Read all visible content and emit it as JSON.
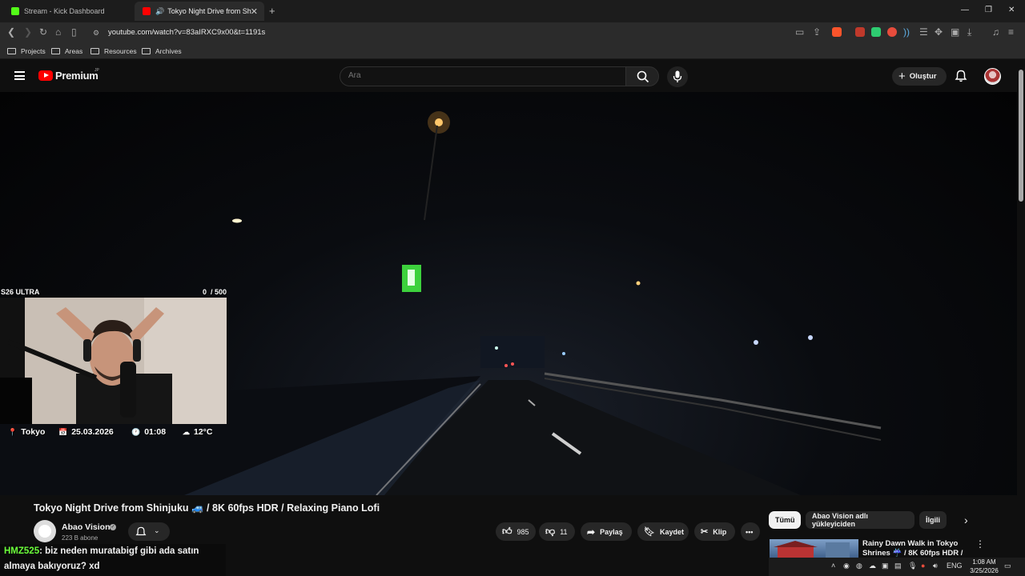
{
  "browser": {
    "tabs": [
      {
        "title": "Stream - Kick Dashboard",
        "active": false
      },
      {
        "title": "Tokyo Night Drive from Shinj",
        "active": true
      }
    ],
    "url": "youtube.com/watch?v=83aIRXC9x00&t=1191s",
    "bookmarks": [
      "Projects",
      "Areas",
      "Resources",
      "Archives"
    ]
  },
  "youtube": {
    "logo_text": "Premium",
    "logo_badge": "JP",
    "search_placeholder": "Ara",
    "create_label": "Oluştur"
  },
  "overlay": {
    "car_label": "S26 ULTRA",
    "counter": "0  / 500",
    "location": "Tokyo",
    "date": "25.03.2026",
    "time": "01:08",
    "temperature": "12°C"
  },
  "video": {
    "title": "Tokyo Night Drive from Shinjuku 🚙 / 8K 60fps HDR / Relaxing Piano Lofi",
    "channel": "Abao Vision",
    "subscribers": "223 B abone",
    "likes": "985",
    "dislikes": "11",
    "share_label": "Paylaş",
    "save_label": "Kaydet",
    "clip_label": "Klip"
  },
  "chips": [
    "Tümü",
    "Abao Vision adlı yükleyiciden",
    "İlgili"
  ],
  "recommendation": {
    "title": "Rainy Dawn Walk in Tokyo Shrines ☔ / 8K 60fps HDR /"
  },
  "chat": {
    "user": "HMZ525",
    "message": ": biz neden muratabigf gibi ada satın almaya bakıyoruz? xd"
  },
  "taskbar": {
    "lang": "ENG",
    "time": "1:08 AM",
    "date": "3/25/2026"
  },
  "colors": {
    "youtube_red": "#ff0000",
    "chat_user_green": "#6bff3a",
    "background": "#0f0f0f"
  }
}
